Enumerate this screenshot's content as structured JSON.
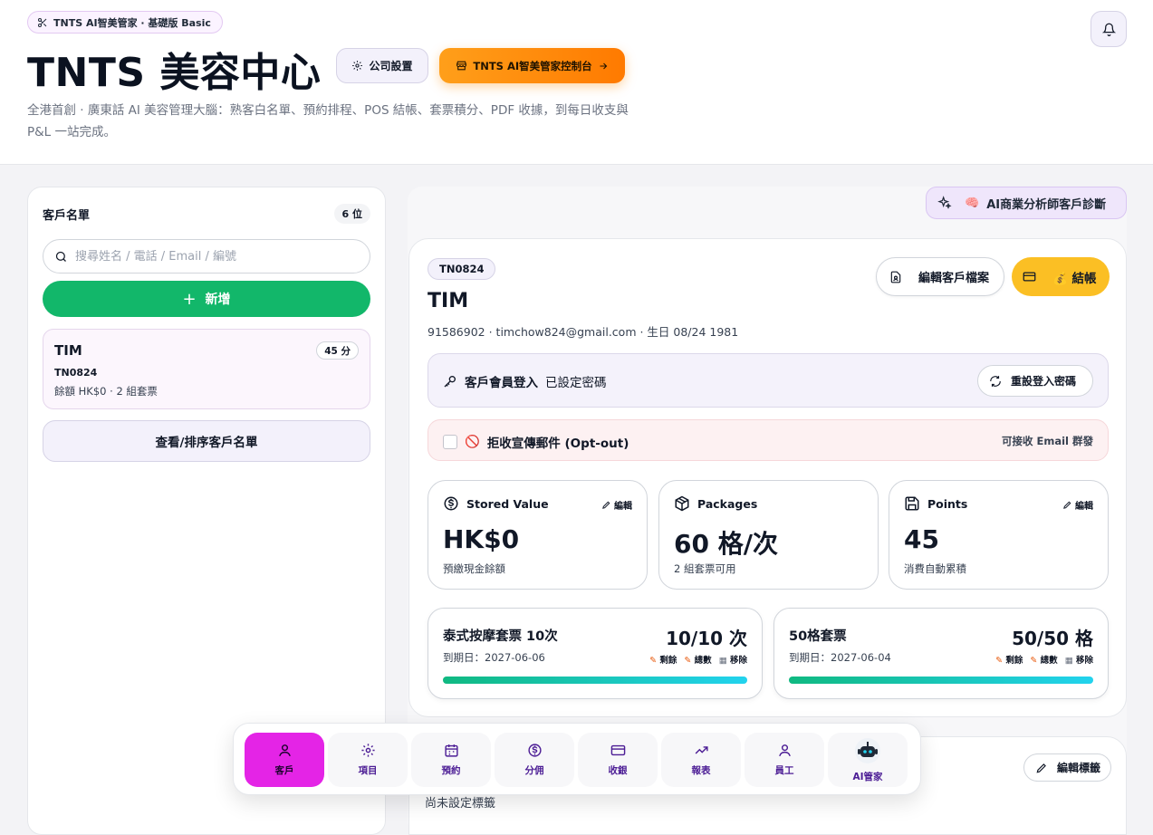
{
  "header": {
    "badge": "TNTS AI智美管家 · 基礎版 Basic",
    "title": "TNTS 美容中心",
    "settings_label": "公司設置",
    "console_label": "TNTS AI智美管家控制台",
    "description": "全港首創 · 廣東話 AI 美容管理大腦：熟客白名單、預約排程、POS 結帳、套票積分、PDF 收據，到每日收支與 P&L 一站完成。"
  },
  "customer_list": {
    "title": "客戶名單",
    "count": "6 位",
    "search_placeholder": "搜尋姓名 / 電話 / Email / 編號",
    "add_label": "新增",
    "customers": [
      {
        "name": "TIM",
        "score": "45 分",
        "code": "TN0824",
        "summary": "餘額 HK$0 · 2 組套票"
      }
    ],
    "sort_label": "查看/排序客戶名單"
  },
  "ai_diagnosis": {
    "emoji": "🧠",
    "label": "AI商業分析師客戶診斷"
  },
  "detail": {
    "code": "TN0824",
    "name": "TIM",
    "meta": "91586902 · timchow824@gmail.com · 生日 08/24 1981",
    "edit_file_label": "編輯客戶檔案",
    "checkout_emoji": "💰",
    "checkout_label": "結帳",
    "login": {
      "title": "客戶會員登入",
      "status": "已設定密碼",
      "reset_label": "重設登入密碼"
    },
    "optout": {
      "emoji": "🚫",
      "label": "拒收宣傳郵件 (Opt-out)",
      "status": "可接收 Email 群發"
    },
    "stats": [
      {
        "title": "Stored Value",
        "value": "HK$0",
        "sub": "預繳現金餘額",
        "edit": "編輯"
      },
      {
        "title": "Packages",
        "value": "60 格/次",
        "sub": "2 組套票可用",
        "edit": ""
      },
      {
        "title": "Points",
        "value": "45",
        "sub": "消費自動累積",
        "edit": "編輯"
      }
    ],
    "packages": [
      {
        "name": "泰式按摩套票 10次",
        "count": "10/10 次",
        "expiry": "到期日：2027-06-06",
        "remaining": 1.0,
        "act_remaining": "剩餘",
        "act_total": "總數",
        "act_remove": "移除"
      },
      {
        "name": "50格套票",
        "count": "50/50 格",
        "expiry": "到期日：2027-06-04",
        "remaining": 1.0,
        "act_remaining": "剩餘",
        "act_total": "總數",
        "act_remove": "移除"
      }
    ],
    "tags": {
      "empty": "尚未設定標籤",
      "edit_label": "編輯標籤"
    }
  },
  "nav": [
    {
      "label": "客戶",
      "icon": "user-icon",
      "active": true
    },
    {
      "label": "項目",
      "icon": "gear-icon",
      "active": false
    },
    {
      "label": "預約",
      "icon": "calendar-icon",
      "active": false
    },
    {
      "label": "分佣",
      "icon": "dollar-icon",
      "active": false
    },
    {
      "label": "收銀",
      "icon": "card-icon",
      "active": false
    },
    {
      "label": "報表",
      "icon": "trend-icon",
      "active": false
    },
    {
      "label": "員工",
      "icon": "user-icon",
      "active": false
    },
    {
      "label": "AI管家",
      "icon": "robot-icon",
      "active": false
    }
  ],
  "colors": {
    "accent_green": "#12b76a",
    "accent_orange": "#ff8a00",
    "accent_yellow": "#fbbf24",
    "nav_active": "#e424e6"
  }
}
